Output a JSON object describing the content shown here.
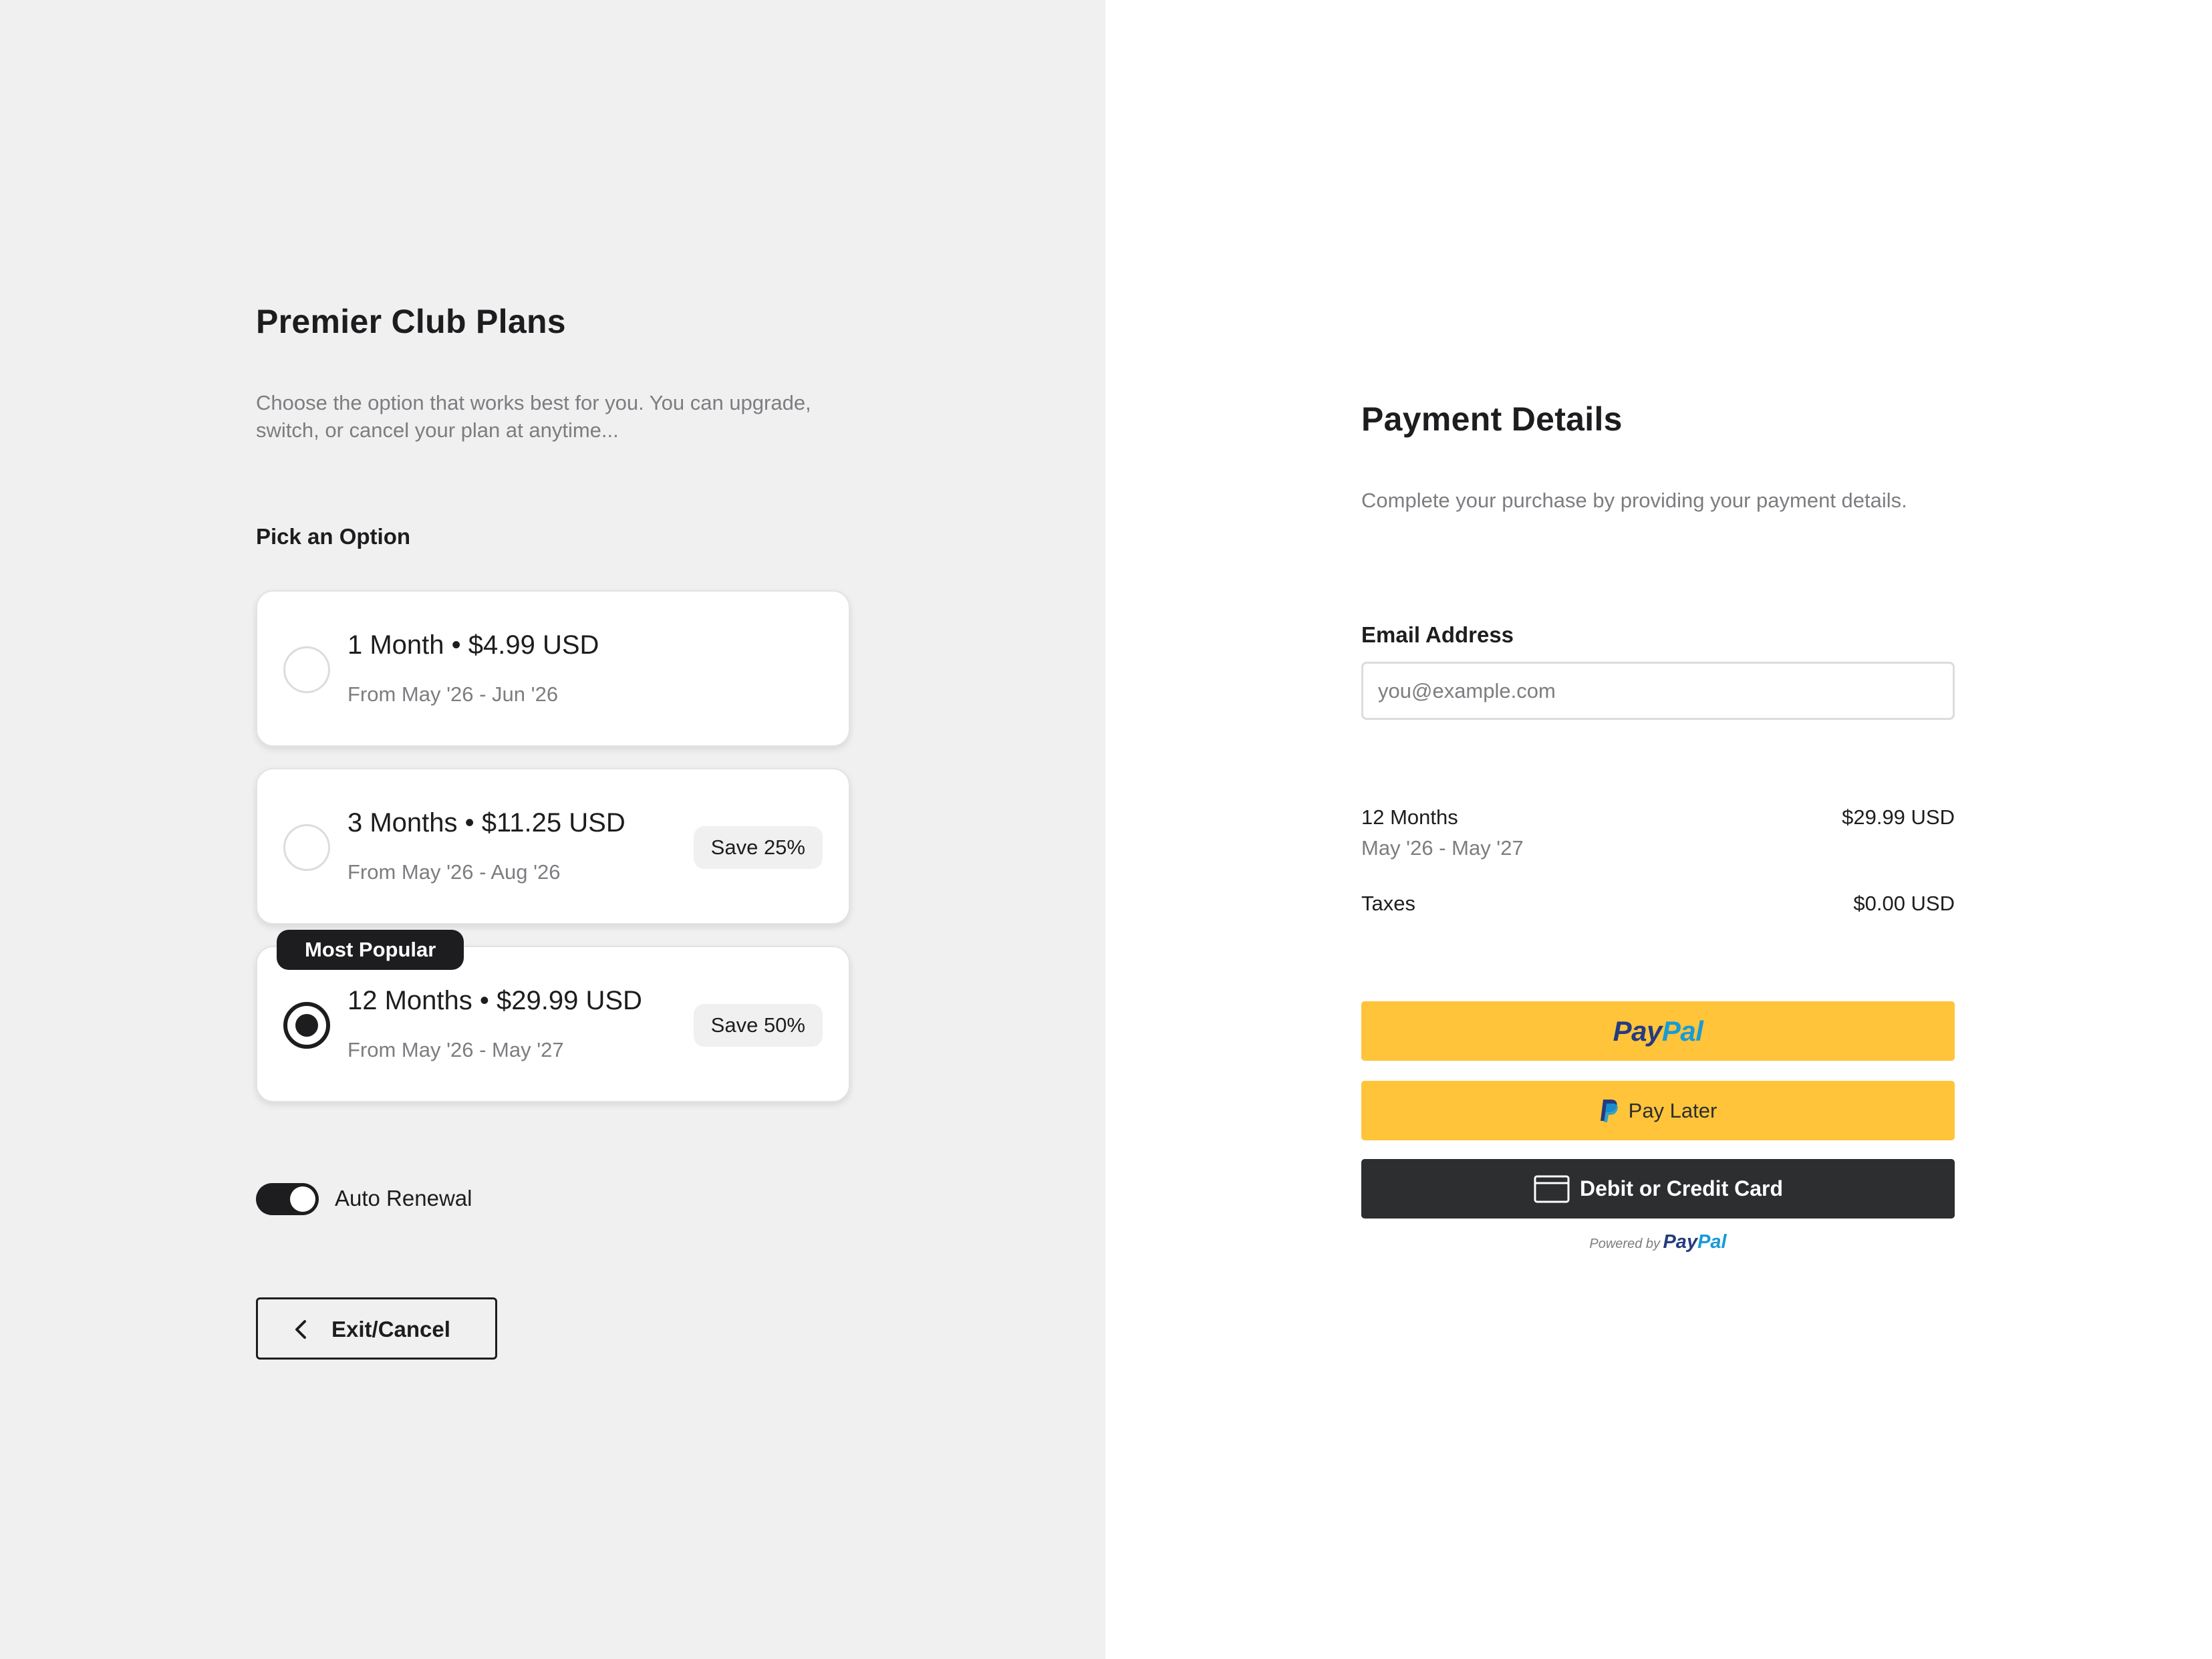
{
  "plans_panel": {
    "title": "Premier Club Plans",
    "description": "Choose the option that works best for you. You can upgrade, switch, or cancel your plan at anytime...",
    "pick_label": "Pick an Option",
    "options": [
      {
        "name": "1 Month • $4.99 USD",
        "range": "From May '26 - Jun '26",
        "badge": "",
        "selected": false
      },
      {
        "name": "3 Months • $11.25 USD",
        "range": "From May '26 - Aug '26",
        "badge": "Save 25%",
        "selected": false
      },
      {
        "name": "12 Months • $29.99 USD",
        "range": "From May '26 - May '27",
        "badge": "Save 50%",
        "selected": true
      }
    ],
    "popular_badge": "Most Popular",
    "auto_renewal": {
      "label": "Auto Renewal",
      "on": true
    },
    "exit_button": "Exit/Cancel"
  },
  "payment_panel": {
    "title": "Payment Details",
    "description": "Complete your purchase by providing your payment details.",
    "email_label": "Email Address",
    "email_placeholder": "you@example.com",
    "summary": {
      "plan_name": "12 Months",
      "plan_range": "May '26 - May '27",
      "plan_price": "$29.99 USD",
      "tax_label": "Taxes",
      "tax_price": "$0.00 USD"
    },
    "buttons": {
      "paypal_part1": "Pay",
      "paypal_part2": "Pal",
      "pay_later": "Pay Later",
      "card": "Debit or Credit Card"
    },
    "powered_by": "Powered by",
    "powered_logo_part1": "Pay",
    "powered_logo_part2": "Pal"
  },
  "colors": {
    "left_bg": "#f0f0f1",
    "text_dark": "#1d1d1f",
    "text_muted": "#7d7d81",
    "paypal_yellow": "#ffc43a",
    "paypal_dark": "#2c2e2f",
    "paypal_navy": "#253b80",
    "paypal_blue": "#179bd7"
  },
  "icons": [
    "chevron-left-icon",
    "paypal-p-icon",
    "credit-card-icon"
  ]
}
